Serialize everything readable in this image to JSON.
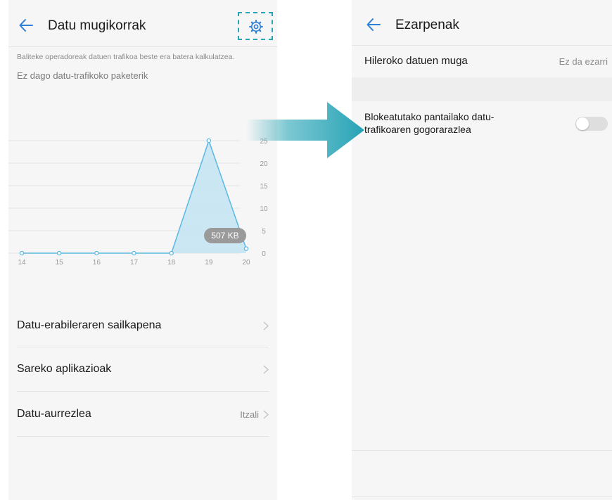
{
  "colors": {
    "accent": "#2f7fd6",
    "highlight": "#26a3b5",
    "chart_fill": "#bfe3f2",
    "chart_line": "#5bb8e3",
    "badge_bg": "#9a9a9a"
  },
  "left": {
    "title": "Datu mugikorrak",
    "back_icon": "arrow-left-icon",
    "settings_icon": "gear-icon",
    "operator_note": "Baliteke operadoreak datuen trafikoa beste era batera kalkulatzea.",
    "package_note": "Ez dago datu-trafikoko paketerik",
    "menu": [
      {
        "label": "Datu-erabileraren sailkapena",
        "value": ""
      },
      {
        "label": "Sareko aplikazioak",
        "value": ""
      },
      {
        "label": "Datu-aurrezlea",
        "value": "Itzali"
      }
    ]
  },
  "right": {
    "title": "Ezarpenak",
    "back_icon": "arrow-left-icon",
    "monthly_limit_label": "Hileroko datuen muga",
    "monthly_limit_value": "Ez da ezarri",
    "lockscreen_line1": "Blokeatutako pantailako datu-",
    "lockscreen_line2": "trafikoaren gogorarazlea",
    "lockscreen_toggle_on": false
  },
  "chart_data": {
    "type": "area",
    "x": [
      "14",
      "15",
      "16",
      "17",
      "18",
      "19",
      "20"
    ],
    "values": [
      0,
      0,
      0,
      0,
      0,
      25,
      1
    ],
    "yticks": [
      "0",
      "5",
      "10",
      "15",
      "20",
      "25"
    ],
    "ylim": [
      0,
      25
    ],
    "badge": "507 KB",
    "grid": true
  }
}
